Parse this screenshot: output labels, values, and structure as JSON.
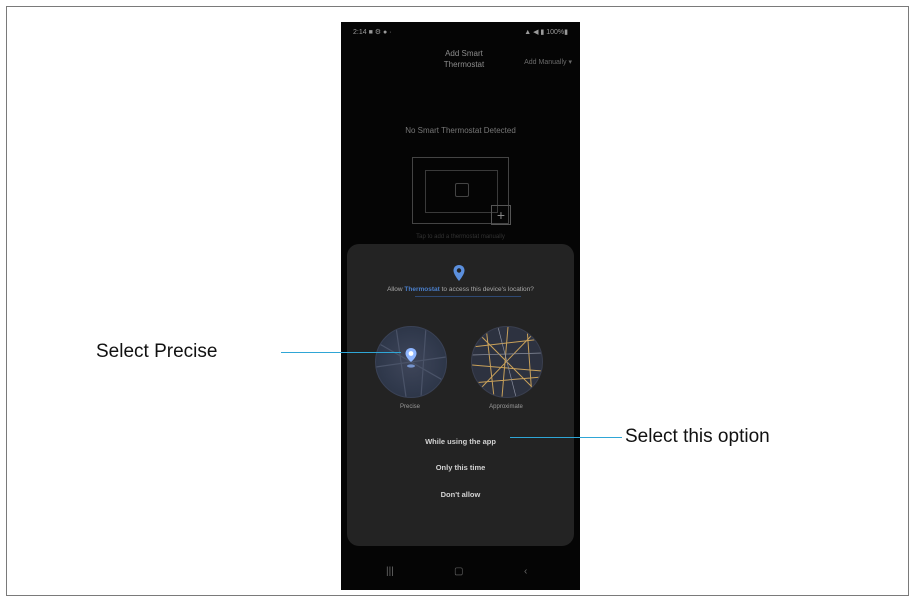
{
  "statusbar": {
    "left": "2:14 ■ ⚙ ● ·",
    "right": "▲ ◀ ▮ 100%▮"
  },
  "header": {
    "title_line1": "Add Smart",
    "title_line2": "Thermostat",
    "menu_label": "Add Manually ▾"
  },
  "no_device_message": "No Smart Thermostat Detected",
  "faint_caption": "Tap to add a thermostat manually",
  "permission_sheet": {
    "question_prefix": "Allow ",
    "app_name": "Thermostat",
    "question_suffix": " to access this device's location?",
    "precise_label": "Precise",
    "approximate_label": "Approximate",
    "options": [
      "While using the app",
      "Only this time",
      "Don't allow"
    ]
  },
  "navbar": {
    "recent": "|||",
    "home": "▢",
    "back": "‹"
  },
  "callouts": {
    "precise": "Select Precise",
    "option": "Select this option"
  },
  "colors": {
    "accent": "#2fa6d6",
    "sheet_bg": "#232323",
    "app_name": "#4a7ec9"
  }
}
